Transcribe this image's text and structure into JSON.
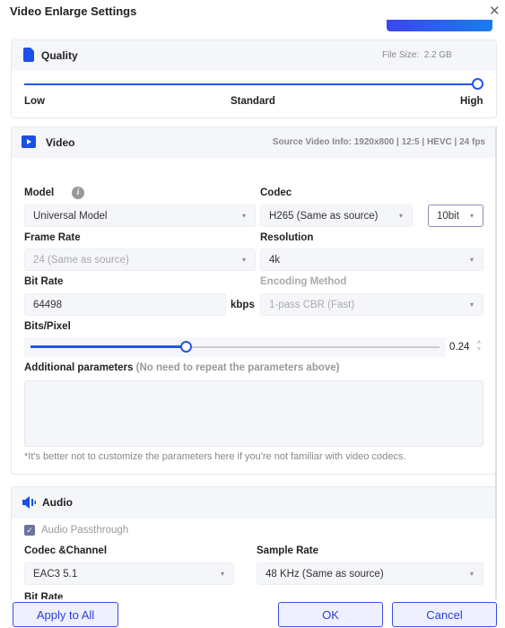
{
  "window": {
    "title": "Video Enlarge Settings"
  },
  "quality": {
    "title": "Quality",
    "file_size_label": "File Size:",
    "file_size": "2.2 GB",
    "levels": [
      "Low",
      "Standard",
      "High"
    ],
    "value": "High",
    "slider_fraction": 1.0
  },
  "video": {
    "title": "Video",
    "source_info": "Source Video Info: 1920x800 | 12:5 | HEVC | 24 fps",
    "model_label": "Model",
    "model": "Universal Model",
    "codec_label": "Codec",
    "codec": "H265 (Same as source)",
    "bit_depth": "10bit",
    "frame_rate_label": "Frame Rate",
    "frame_rate": "24 (Same as source)",
    "resolution_label": "Resolution",
    "resolution": "4k",
    "bit_rate_label": "Bit Rate",
    "bit_rate": "64498",
    "bit_rate_unit": "kbps",
    "encoding_label": "Encoding Method",
    "encoding": "1-pass CBR (Fast)",
    "bpp_label": "Bits/Pixel",
    "bpp": "0.24",
    "bpp_fraction": 0.38,
    "params_label": "Additional parameters",
    "params_hint": "(No need to repeat the parameters above)",
    "params_value": "",
    "note": "*It's better not to customize the parameters here if you're not familiar with video codecs."
  },
  "audio": {
    "title": "Audio",
    "passthrough_label": "Audio Passthrough",
    "passthrough": true,
    "codec_label": "Codec &Channel",
    "codec": "EAC3 5.1",
    "sample_rate_label": "Sample Rate",
    "sample_rate": "48 KHz (Same as source)",
    "bit_rate_label": "Bit Rate"
  },
  "footer": {
    "apply_all": "Apply to All",
    "ok": "OK",
    "cancel": "Cancel"
  },
  "colors": {
    "accent": "#2a3de0",
    "slider": "#2457e6"
  }
}
